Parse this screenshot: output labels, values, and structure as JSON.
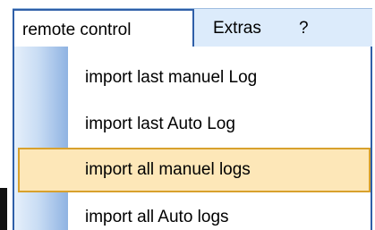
{
  "menubar": {
    "items": [
      {
        "label": "remote control",
        "state": "open"
      },
      {
        "label": "Extras"
      },
      {
        "label": "?"
      }
    ]
  },
  "dropdown": {
    "items": [
      {
        "label": "import last manuel Log"
      },
      {
        "label": "import last Auto Log"
      },
      {
        "label": "import all manuel logs",
        "state": "highlighted"
      },
      {
        "label": "import all Auto logs"
      }
    ]
  },
  "colors": {
    "menubar_bg": "#dcebfb",
    "active_border": "#2f5fa8",
    "highlight_bg": "#fde7b8",
    "highlight_border": "#d8a12d",
    "gutter_gradient": [
      "#e6f0fb",
      "#8fb3e2"
    ]
  }
}
